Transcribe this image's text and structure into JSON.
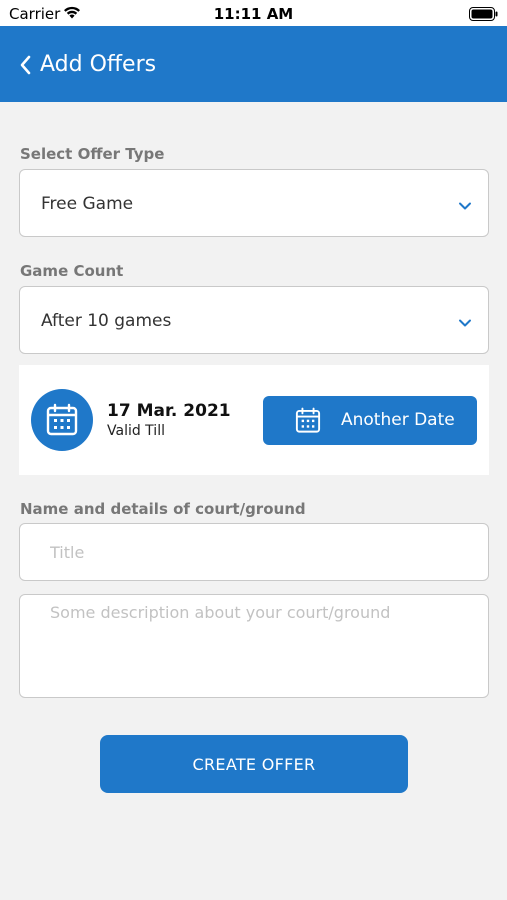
{
  "status_bar": {
    "carrier": "Carrier",
    "time": "11:11 AM",
    "icons": [
      "wifi-icon",
      "battery-icon"
    ]
  },
  "nav": {
    "title": "Add Offers",
    "back_icon": "chevron-left-icon"
  },
  "offer_type": {
    "label": "Select Offer Type",
    "value": "Free Game"
  },
  "game_count": {
    "label": "Game Count",
    "value": "After 10 games"
  },
  "valid_till": {
    "date": "17 Mar. 2021",
    "caption": "Valid Till",
    "another_date_label": "Another Date"
  },
  "court": {
    "label": "Name and details of court/ground",
    "title_placeholder": "Title",
    "description_placeholder": "Some description about your court/ground"
  },
  "submit": {
    "label": "CREATE OFFER"
  },
  "colors": {
    "primary": "#1f78c9",
    "background": "#f2f2f2",
    "label_gray": "#777777",
    "placeholder_gray": "#c2c2c2"
  }
}
